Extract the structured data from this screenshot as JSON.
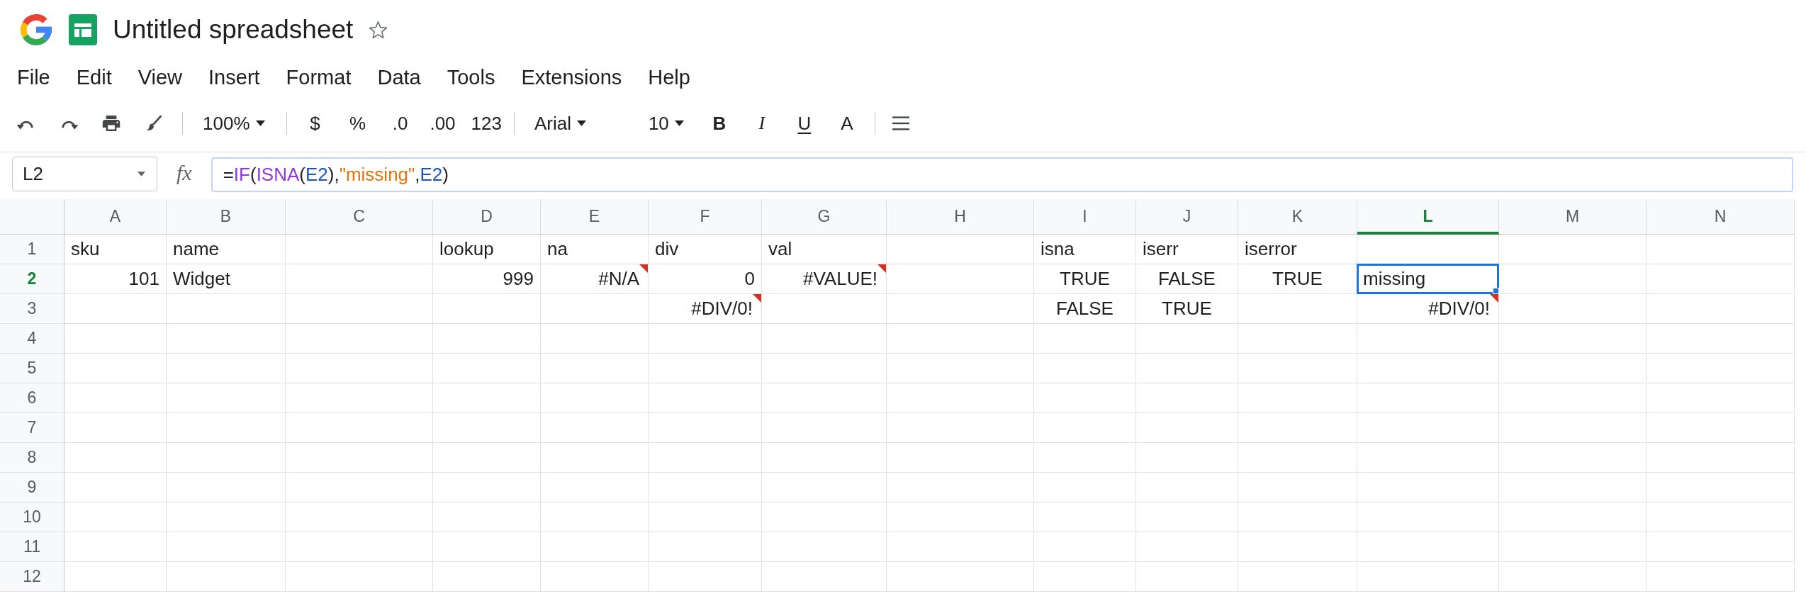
{
  "header": {
    "title": "Untitled spreadsheet",
    "starred": false
  },
  "menu": [
    "File",
    "Edit",
    "View",
    "Insert",
    "Format",
    "Data",
    "Tools",
    "Extensions",
    "Help"
  ],
  "toolbar": {
    "zoom": "100%",
    "number_formats": [
      "$",
      "%",
      ".0",
      ".00",
      "123"
    ],
    "font": "Arial",
    "font_size": "10",
    "text_styles": [
      {
        "label": "B",
        "kind": "bold"
      },
      {
        "label": "I",
        "kind": "italic"
      },
      {
        "label": "U",
        "kind": "underline"
      },
      {
        "label": "A",
        "kind": "color"
      }
    ]
  },
  "formula_bar": {
    "cell_ref": "L2",
    "fx": "fx",
    "tokens": [
      {
        "text": "=",
        "color": "#202124"
      },
      {
        "text": "IF",
        "color": "#9334e6"
      },
      {
        "text": "(",
        "color": "#202124"
      },
      {
        "text": "ISNA",
        "color": "#9334e6"
      },
      {
        "text": "(",
        "color": "#202124"
      },
      {
        "text": "E2",
        "color": "#1a56c9"
      },
      {
        "text": "),",
        "color": "#202124"
      },
      {
        "text": "\"missing\"",
        "color": "#e8710a"
      },
      {
        "text": ",",
        "color": "#202124"
      },
      {
        "text": "E2",
        "color": "#1a56c9"
      },
      {
        "text": ")",
        "color": "#202124"
      }
    ]
  },
  "sheet": {
    "columns": [
      {
        "label": "A",
        "selected": false
      },
      {
        "label": "B",
        "selected": false
      },
      {
        "label": "C",
        "selected": false
      },
      {
        "label": "D",
        "selected": false
      },
      {
        "label": "E",
        "selected": false
      },
      {
        "label": "F",
        "selected": false
      },
      {
        "label": "G",
        "selected": false
      },
      {
        "label": "H",
        "selected": false
      },
      {
        "label": "I",
        "selected": false
      },
      {
        "label": "J",
        "selected": false
      },
      {
        "label": "K",
        "selected": false
      },
      {
        "label": "L",
        "selected": true
      },
      {
        "label": "M",
        "selected": false
      },
      {
        "label": "N",
        "selected": false
      }
    ],
    "rows": [
      {
        "number": "1",
        "selected": false,
        "cells": [
          {
            "value": "sku",
            "kind": "text",
            "selected": false
          },
          {
            "value": "name",
            "kind": "text",
            "selected": false
          },
          null,
          {
            "value": "lookup",
            "kind": "text",
            "selected": false
          },
          {
            "value": "na",
            "kind": "text",
            "selected": false
          },
          {
            "value": "div",
            "kind": "text",
            "selected": false
          },
          {
            "value": "val",
            "kind": "text",
            "selected": false
          },
          null,
          {
            "value": "isna",
            "kind": "text",
            "selected": false
          },
          {
            "value": "iserr",
            "kind": "text",
            "selected": false
          },
          {
            "value": "iserror",
            "kind": "text",
            "selected": false
          }
        ]
      },
      {
        "number": "2",
        "selected": true,
        "cells": [
          {
            "value": "101",
            "kind": "number",
            "selected": false
          },
          {
            "value": "Widget",
            "kind": "text",
            "selected": false
          },
          null,
          {
            "value": "999",
            "kind": "number",
            "selected": false
          },
          {
            "value": "#N/A",
            "kind": "error",
            "selected": false
          },
          {
            "value": "0",
            "kind": "number",
            "selected": false
          },
          {
            "value": "#VALUE!",
            "kind": "error",
            "selected": false
          },
          null,
          {
            "value": "TRUE",
            "kind": "boolean",
            "selected": false
          },
          {
            "value": "FALSE",
            "kind": "boolean",
            "selected": false
          },
          {
            "value": "TRUE",
            "kind": "boolean",
            "selected": false
          },
          {
            "value": "missing",
            "kind": "text",
            "selected": true
          }
        ]
      },
      {
        "number": "3",
        "selected": false,
        "cells": [
          null,
          null,
          null,
          null,
          null,
          {
            "value": "#DIV/0!",
            "kind": "error",
            "selected": false
          },
          null,
          null,
          {
            "value": "FALSE",
            "kind": "boolean",
            "selected": false
          },
          {
            "value": "TRUE",
            "kind": "boolean",
            "selected": false
          },
          null,
          {
            "value": "#DIV/0!",
            "kind": "error",
            "selected": false
          }
        ]
      },
      {
        "number": "4",
        "selected": false
      },
      {
        "number": "5",
        "selected": false
      },
      {
        "number": "6",
        "selected": false
      },
      {
        "number": "7",
        "selected": false
      },
      {
        "number": "8",
        "selected": false
      },
      {
        "number": "9",
        "selected": false
      },
      {
        "number": "10",
        "selected": false
      },
      {
        "number": "11",
        "selected": false
      },
      {
        "number": "12",
        "selected": false
      }
    ]
  }
}
